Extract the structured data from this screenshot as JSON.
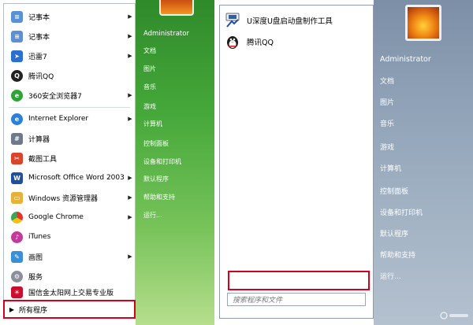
{
  "left_menu": {
    "items": [
      {
        "label": "记事本",
        "icon": "notepad-icon",
        "color": "#5b8fd6",
        "arrow": true
      },
      {
        "label": "记事本",
        "icon": "notepad-icon",
        "color": "#5b8fd6",
        "arrow": true
      },
      {
        "label": "迅雷7",
        "icon": "thunder-icon",
        "color": "#2a6fd1",
        "arrow": true
      },
      {
        "label": "腾讯QQ",
        "icon": "qq-penguin-icon",
        "color": "#222222",
        "arrow": false
      },
      {
        "label": "360安全浏览器7",
        "icon": "360-browser-icon",
        "color": "#2fa338",
        "arrow": true
      },
      {
        "label": "Internet Explorer",
        "icon": "ie-icon",
        "color": "#2d7fd8",
        "arrow": true
      },
      {
        "label": "计算器",
        "icon": "calculator-icon",
        "color": "#6d7a8c",
        "arrow": false
      },
      {
        "label": "截图工具",
        "icon": "snipping-tool-icon",
        "color": "#d9452c",
        "arrow": false
      },
      {
        "label": "Microsoft Office Word 2003",
        "icon": "word-icon",
        "color": "#1f4fa3",
        "arrow": true
      },
      {
        "label": "Windows 资源管理器",
        "icon": "explorer-folder-icon",
        "color": "#e6b238",
        "arrow": true
      },
      {
        "label": "Google Chrome",
        "icon": "chrome-icon",
        "color": "#e0362c",
        "arrow": true
      },
      {
        "label": "iTunes",
        "icon": "itunes-icon",
        "color": "#c23a9a",
        "arrow": false
      },
      {
        "label": "画图",
        "icon": "paint-icon",
        "color": "#3a8fd6",
        "arrow": true
      },
      {
        "label": "服务",
        "icon": "services-gear-icon",
        "color": "#8a8f99",
        "arrow": false
      },
      {
        "label": "国信金太阳网上交易专业版",
        "icon": "sun-trading-icon",
        "color": "#c8102e",
        "arrow": false
      }
    ],
    "all_programs": "所有程序",
    "right_links": {
      "user": "Administrator",
      "links": [
        "文档",
        "图片",
        "音乐",
        "游戏",
        "计算机",
        "控制面板",
        "设备和打印机",
        "默认程序",
        "帮助和支持",
        "运行..."
      ]
    }
  },
  "right_menu": {
    "pinned": [
      {
        "label": "U深度U盘启动盘制作工具",
        "icon": "usb-tool-icon"
      },
      {
        "label": "腾讯QQ",
        "icon": "qq-penguin-icon"
      }
    ],
    "search_placeholder": "搜索程序和文件",
    "side": {
      "user": "Administrator",
      "links": [
        "文档",
        "图片",
        "音乐",
        "游戏",
        "计算机",
        "控制面板",
        "设备和打印机",
        "默认程序",
        "帮助和支持",
        "运行..."
      ]
    }
  },
  "colors": {
    "highlight_box": "#d4001e",
    "left_side_green": "#46a83a",
    "right_side_steel": "#8fa1b6"
  }
}
